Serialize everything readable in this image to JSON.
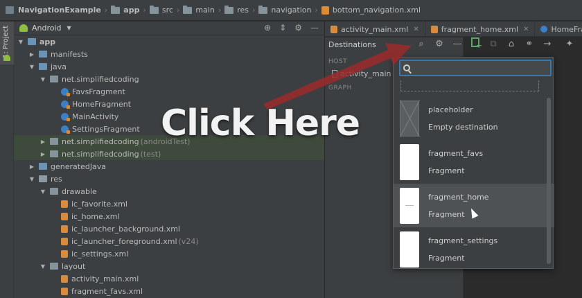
{
  "breadcrumb": [
    {
      "label": "NavigationExample",
      "icon": "project-icon",
      "bold": true
    },
    {
      "label": "app",
      "icon": "folder-icon",
      "bold": true
    },
    {
      "label": "src",
      "icon": "folder-icon",
      "bold": false
    },
    {
      "label": "main",
      "icon": "folder-icon",
      "bold": false
    },
    {
      "label": "res",
      "icon": "folder-icon",
      "bold": false
    },
    {
      "label": "navigation",
      "icon": "folder-icon",
      "bold": false
    },
    {
      "label": "bottom_navigation.xml",
      "icon": "xml-file-icon",
      "bold": false
    }
  ],
  "toolwindow": {
    "tab_label": "1: Project"
  },
  "project": {
    "view_label": "Android",
    "tree": [
      {
        "label": "app",
        "muted": "",
        "indent": 0,
        "arrow": "down",
        "icon": "folder-blue",
        "bold": true
      },
      {
        "label": "manifests",
        "muted": "",
        "indent": 1,
        "arrow": "right",
        "icon": "folder-blue"
      },
      {
        "label": "java",
        "muted": "",
        "indent": 1,
        "arrow": "down",
        "icon": "folder-blue"
      },
      {
        "label": "net.simplifiedcoding",
        "muted": "",
        "indent": 2,
        "arrow": "down",
        "icon": "package"
      },
      {
        "label": "FavsFragment",
        "muted": "",
        "indent": 3,
        "arrow": "",
        "icon": "class"
      },
      {
        "label": "HomeFragment",
        "muted": "",
        "indent": 3,
        "arrow": "",
        "icon": "class"
      },
      {
        "label": "MainActivity",
        "muted": "",
        "indent": 3,
        "arrow": "",
        "icon": "class"
      },
      {
        "label": "SettingsFragment",
        "muted": "",
        "indent": 3,
        "arrow": "",
        "icon": "class"
      },
      {
        "label": "net.simplifiedcoding",
        "muted": "(androidTest)",
        "indent": 2,
        "arrow": "right",
        "icon": "package"
      },
      {
        "label": "net.simplifiedcoding",
        "muted": "(test)",
        "indent": 2,
        "arrow": "right",
        "icon": "package"
      },
      {
        "label": "generatedJava",
        "muted": "",
        "indent": 1,
        "arrow": "right",
        "icon": "folder-blue"
      },
      {
        "label": "res",
        "muted": "",
        "indent": 1,
        "arrow": "down",
        "icon": "folder-res"
      },
      {
        "label": "drawable",
        "muted": "",
        "indent": 2,
        "arrow": "down",
        "icon": "folder"
      },
      {
        "label": "ic_favorite.xml",
        "muted": "",
        "indent": 3,
        "arrow": "",
        "icon": "xml"
      },
      {
        "label": "ic_home.xml",
        "muted": "",
        "indent": 3,
        "arrow": "",
        "icon": "xml"
      },
      {
        "label": "ic_launcher_background.xml",
        "muted": "",
        "indent": 3,
        "arrow": "",
        "icon": "xml"
      },
      {
        "label": "ic_launcher_foreground.xml",
        "muted": "(v24)",
        "indent": 3,
        "arrow": "",
        "icon": "xml"
      },
      {
        "label": "ic_settings.xml",
        "muted": "",
        "indent": 3,
        "arrow": "",
        "icon": "xml"
      },
      {
        "label": "layout",
        "muted": "",
        "indent": 2,
        "arrow": "down",
        "icon": "folder"
      },
      {
        "label": "activity_main.xml",
        "muted": "",
        "indent": 3,
        "arrow": "",
        "icon": "xml"
      },
      {
        "label": "fragment_favs.xml",
        "muted": "",
        "indent": 3,
        "arrow": "",
        "icon": "xml"
      }
    ]
  },
  "tabs": [
    {
      "label": "activity_main.xml",
      "icon": "xml-file-icon"
    },
    {
      "label": "fragment_home.xml",
      "icon": "xml-file-icon"
    },
    {
      "label": "HomeFragment.",
      "icon": "class-icon"
    }
  ],
  "destinations": {
    "title": "Destinations",
    "host_label": "HOST",
    "host_item": "activity_main (fr",
    "graph_label": "GRAPH"
  },
  "popup": {
    "items": [
      {
        "name": "placeholder",
        "type": "Empty destination",
        "thumb": "placeholder"
      },
      {
        "name": "fragment_favs",
        "type": "Fragment",
        "thumb": "blank"
      },
      {
        "name": "fragment_home",
        "type": "Fragment",
        "thumb": "line"
      },
      {
        "name": "fragment_settings",
        "type": "Fragment",
        "thumb": "blank"
      }
    ],
    "hovered_index": 2
  },
  "overlay": {
    "text": "Click Here",
    "arrow_color": "#9b2a2a"
  }
}
